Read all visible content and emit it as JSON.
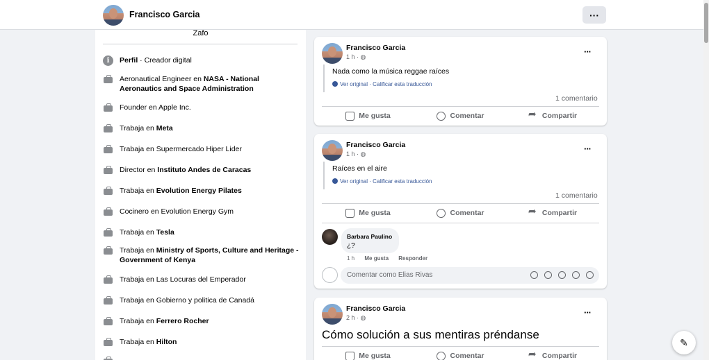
{
  "topbar": {
    "profile_name": "Francisco Garcia",
    "more_label": "···"
  },
  "intro": {
    "top_text": "Zafo",
    "rows": [
      {
        "prefix": "",
        "bold": "Perfil",
        "suffix": " · Creador digital",
        "icon": "info-icon"
      },
      {
        "prefix": "Aeronautical Engineer en ",
        "bold": "NASA - National Aeronautics and Space Administration",
        "suffix": "",
        "icon": "briefcase-icon"
      },
      {
        "prefix": "Founder en Apple Inc.",
        "bold": "",
        "suffix": "",
        "icon": "briefcase-icon"
      },
      {
        "prefix": "Trabaja en ",
        "bold": "Meta",
        "suffix": "",
        "icon": "briefcase-icon"
      },
      {
        "prefix": "Trabaja en Supermercado Hiper Lider",
        "bold": "",
        "suffix": "",
        "icon": "briefcase-icon"
      },
      {
        "prefix": "Director en ",
        "bold": "Instituto Andes de Caracas",
        "suffix": "",
        "icon": "briefcase-icon"
      },
      {
        "prefix": "Trabaja en ",
        "bold": "Evolution Energy Pilates",
        "suffix": "",
        "icon": "briefcase-icon"
      },
      {
        "prefix": "Cocinero en Evolution Energy Gym",
        "bold": "",
        "suffix": "",
        "icon": "briefcase-icon"
      },
      {
        "prefix": "Trabaja en ",
        "bold": "Tesla",
        "suffix": "",
        "icon": "briefcase-icon"
      },
      {
        "prefix": "Trabaja en ",
        "bold": "Ministry of Sports, Culture and Heritage - Government of Kenya",
        "suffix": "",
        "icon": "briefcase-icon"
      },
      {
        "prefix": "Trabaja en Las Locuras del Emperador",
        "bold": "",
        "suffix": "",
        "icon": "briefcase-icon"
      },
      {
        "prefix": "Trabaja en Gobierno y politica de Canadá",
        "bold": "",
        "suffix": "",
        "icon": "briefcase-icon"
      },
      {
        "prefix": "Trabaja en ",
        "bold": "Ferrero Rocher",
        "suffix": "",
        "icon": "briefcase-icon"
      },
      {
        "prefix": "Trabaja en ",
        "bold": "Hilton",
        "suffix": "",
        "icon": "briefcase-icon"
      }
    ]
  },
  "posts": [
    {
      "author": "Francisco Garcia",
      "time": "1 h ·",
      "text": "Nada como la música reggae raíces",
      "translation": "Ver original · Calificar esta traducción",
      "comments_count": "1 comentario",
      "like": "Me gusta",
      "comment": "Comentar",
      "share": "Compartir"
    },
    {
      "author": "Francisco Garcia",
      "time": "1 h ·",
      "text": "Raíces en el aire",
      "translation": "Ver original · Calificar esta traducción",
      "comments_count": "1 comentario",
      "like": "Me gusta",
      "comment": "Comentar",
      "share": "Compartir",
      "reply": {
        "author": "Barbara Paulino",
        "text": "¿?",
        "time": "1 h",
        "like": "Me gusta",
        "respond": "Responder"
      },
      "comment_placeholder": "Comentar como Elias Rivas"
    },
    {
      "author": "Francisco Garcia",
      "time": "2 h ·",
      "text": "Cómo solución a sus mentiras préndanse",
      "like": "Me gusta",
      "comment": "Comentar",
      "share": "Compartir"
    }
  ]
}
